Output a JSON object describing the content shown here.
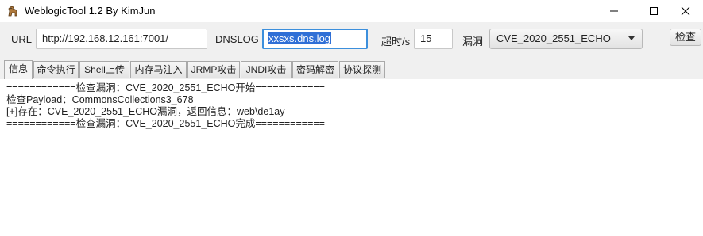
{
  "window": {
    "title": "WeblogicTool 1.2 By KimJun",
    "app_icon": "horse-icon",
    "controls": [
      "minimize-icon",
      "maximize-icon",
      "close-icon"
    ]
  },
  "toolbar": {
    "url_label": "URL",
    "url_value": "http://192.168.12.161:7001/",
    "dnslog_label": "DNSLOG",
    "dnslog_value": "xxsxs.dns.log",
    "timeout_label": "超时/s",
    "timeout_value": "15",
    "vuln_label": "漏洞",
    "vuln_selected": "CVE_2020_2551_ECHO",
    "check_button": "检查"
  },
  "tabs": [
    {
      "label": "信息",
      "active": true
    },
    {
      "label": "命令执行",
      "active": false
    },
    {
      "label": "Shell上传",
      "active": false
    },
    {
      "label": "内存马注入",
      "active": false
    },
    {
      "label": "JRMP攻击",
      "active": false
    },
    {
      "label": "JNDI攻击",
      "active": false
    },
    {
      "label": "密码解密",
      "active": false
    },
    {
      "label": "协议探测",
      "active": false
    }
  ],
  "output": {
    "lines": [
      "============检查漏洞：CVE_2020_2551_ECHO开始============",
      "检查Payload：CommonsCollections3_678",
      "[+]存在：CVE_2020_2551_ECHO漏洞，返回信息：web\\de1ay",
      "============检查漏洞：CVE_2020_2551_ECHO完成============"
    ]
  },
  "colors": {
    "selection": "#2f6fd6",
    "focus_border": "#3c8fdc",
    "toolbar_bg": "#f0f0f0"
  }
}
